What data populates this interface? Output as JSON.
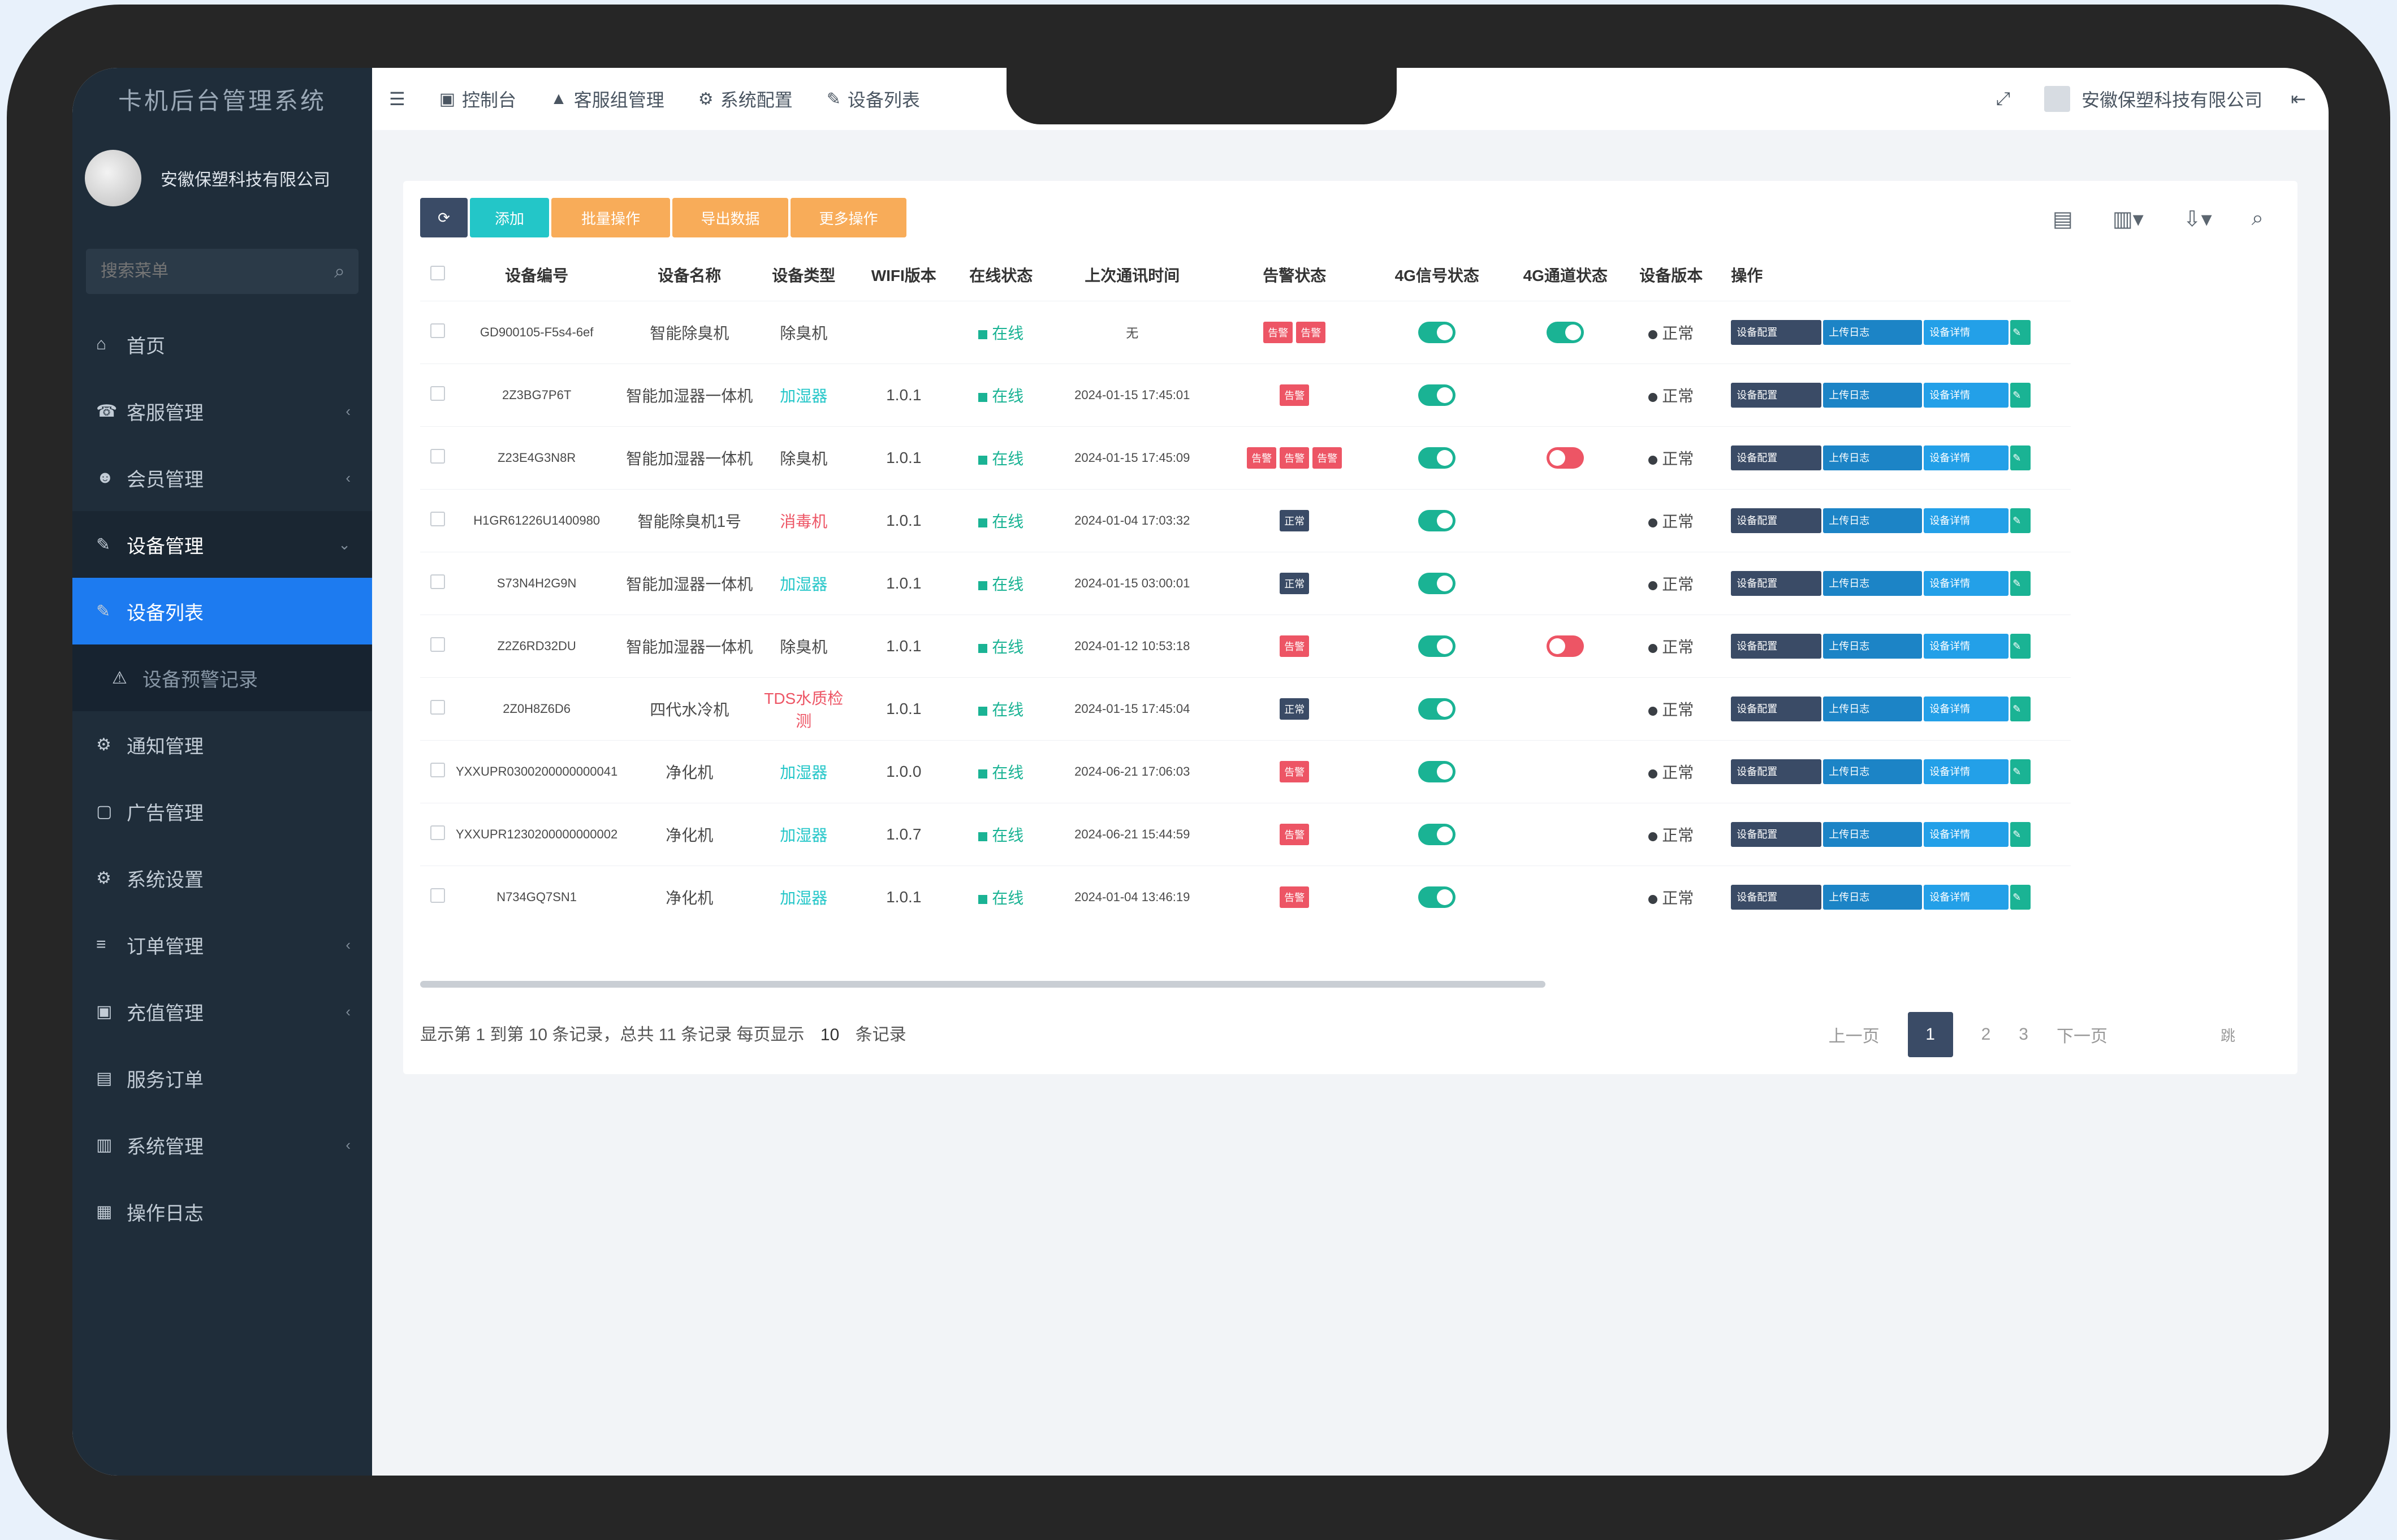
{
  "app": {
    "title": "卡机后台管理系统"
  },
  "user": {
    "name": "安徽保塑科技有限公司"
  },
  "sidebar": {
    "search_placeholder": "搜索菜单",
    "items": [
      {
        "label": "首页",
        "icon": "home-icon"
      },
      {
        "label": "客服管理",
        "icon": "headset-icon",
        "chevron": "‹"
      },
      {
        "label": "会员管理",
        "icon": "users-icon",
        "chevron": "‹"
      },
      {
        "label": "设备管理",
        "icon": "device-icon",
        "chevron": "⌄"
      },
      {
        "label": "设备列表",
        "icon": "list-icon"
      },
      {
        "label": "设备预警记录",
        "icon": "alert-icon"
      },
      {
        "label": "通知管理",
        "icon": "bell-icon"
      },
      {
        "label": "广告管理",
        "icon": "ad-icon"
      },
      {
        "label": "系统设置",
        "icon": "gear-icon"
      },
      {
        "label": "订单管理",
        "icon": "order-icon",
        "chevron": "‹"
      },
      {
        "label": "充值管理",
        "icon": "wallet-icon",
        "chevron": "‹"
      },
      {
        "label": "服务订单",
        "icon": "service-icon"
      },
      {
        "label": "系统管理",
        "icon": "system-icon",
        "chevron": "‹"
      },
      {
        "label": "操作日志",
        "icon": "log-icon"
      }
    ]
  },
  "topbar": {
    "menu_icon": "☰",
    "tabs": [
      {
        "label": "控制台",
        "icon": "▣"
      },
      {
        "label": "客服组管理",
        "icon": "▲"
      },
      {
        "label": "系统配置",
        "icon": "⚙"
      },
      {
        "label": "设备列表",
        "icon": "✎"
      }
    ],
    "fullscreen_icon": "⤢",
    "company": "安徽保塑科技有限公司",
    "collapse_icon": "⇤"
  },
  "toolbar": {
    "refresh_icon": "⟳",
    "add": "添加",
    "btn2": "批量操作",
    "btn3": "导出数据",
    "btn4": "更多操作"
  },
  "table": {
    "headers": [
      "设备编号",
      "设备名称",
      "设备类型",
      "WIFI版本",
      "在线状态",
      "上次通讯时间",
      "告警状态",
      "4G信号状态",
      "4G通道状态",
      "设备版本",
      "操作"
    ],
    "rows": [
      {
        "id": "GD900105-F5s4-6ef",
        "name": "智能除臭机",
        "type": "除臭机",
        "type_color": "normal",
        "wifi": "",
        "online": "在线",
        "last": "无",
        "alerts": [
          {
            "t": "告警",
            "c": "red"
          },
          {
            "t": "告警",
            "c": "red"
          }
        ],
        "sig": "on",
        "ch": "on",
        "status": "正常"
      },
      {
        "id": "2Z3BG7P6T",
        "name": "智能加湿器一体机",
        "type": "加湿器",
        "type_color": "cyan",
        "wifi": "1.0.1",
        "online": "在线",
        "last": "2024-01-15 17:45:01",
        "alerts": [
          {
            "t": "告警",
            "c": "red"
          }
        ],
        "sig": "on",
        "ch": "",
        "status": "正常"
      },
      {
        "id": "Z23E4G3N8R",
        "name": "智能加湿器一体机",
        "type": "除臭机",
        "type_color": "normal",
        "wifi": "1.0.1",
        "online": "在线",
        "last": "2024-01-15 17:45:09",
        "alerts": [
          {
            "t": "告警",
            "c": "red"
          },
          {
            "t": "告警",
            "c": "red"
          },
          {
            "t": "告警",
            "c": "red"
          }
        ],
        "sig": "on",
        "ch": "off",
        "status": "正常"
      },
      {
        "id": "H1GR61226U1400980",
        "name": "智能除臭机1号",
        "type": "消毒机",
        "type_color": "red",
        "wifi": "1.0.1",
        "online": "在线",
        "last": "2024-01-04 17:03:32",
        "alerts": [
          {
            "t": "正常",
            "c": "dark"
          }
        ],
        "sig": "on",
        "ch": "",
        "status": "正常"
      },
      {
        "id": "S73N4H2G9N",
        "name": "智能加湿器一体机",
        "type": "加湿器",
        "type_color": "cyan",
        "wifi": "1.0.1",
        "online": "在线",
        "last": "2024-01-15 03:00:01",
        "alerts": [
          {
            "t": "正常",
            "c": "dark"
          }
        ],
        "sig": "on",
        "ch": "",
        "status": "正常"
      },
      {
        "id": "Z2Z6RD32DU",
        "name": "智能加湿器一体机",
        "type": "除臭机",
        "type_color": "normal",
        "wifi": "1.0.1",
        "online": "在线",
        "last": "2024-01-12 10:53:18",
        "alerts": [
          {
            "t": "告警",
            "c": "red"
          }
        ],
        "sig": "on",
        "ch": "off",
        "status": "正常"
      },
      {
        "id": "2Z0H8Z6D6",
        "name": "四代水冷机",
        "type": "TDS水质检测",
        "type_color": "red",
        "wifi": "1.0.1",
        "online": "在线",
        "last": "2024-01-15 17:45:04",
        "alerts": [
          {
            "t": "正常",
            "c": "dark"
          }
        ],
        "sig": "on",
        "ch": "",
        "status": "正常"
      },
      {
        "id": "YXXUPR0300200000000041",
        "name": "净化机",
        "type": "加湿器",
        "type_color": "cyan",
        "wifi": "1.0.0",
        "online": "在线",
        "last": "2024-06-21 17:06:03",
        "alerts": [
          {
            "t": "告警",
            "c": "red"
          }
        ],
        "sig": "on",
        "ch": "",
        "status": "正常"
      },
      {
        "id": "YXXUPR1230200000000002",
        "name": "净化机",
        "type": "加湿器",
        "type_color": "cyan",
        "wifi": "1.0.7",
        "online": "在线",
        "last": "2024-06-21 15:44:59",
        "alerts": [
          {
            "t": "告警",
            "c": "red"
          }
        ],
        "sig": "on",
        "ch": "",
        "status": "正常"
      },
      {
        "id": "N734GQ7SN1",
        "name": "净化机",
        "type": "加湿器",
        "type_color": "cyan",
        "wifi": "1.0.1",
        "online": "在线",
        "last": "2024-01-04 13:46:19",
        "alerts": [
          {
            "t": "告警",
            "c": "red"
          }
        ],
        "sig": "on",
        "ch": "",
        "status": "正常"
      }
    ],
    "ops": {
      "op1": "设备配置",
      "op2": "上传日志",
      "op3": "设备详情",
      "op4": "✎"
    }
  },
  "pager": {
    "info": "显示第 1 到第 10 条记录，总共 11 条记录 每页显示",
    "per_page": "10",
    "suffix": "条记录",
    "prev": "上一页",
    "pages": [
      "1",
      "2",
      "3"
    ],
    "next": "下一页",
    "jump": "跳"
  },
  "colors": {
    "sidebar_bg": "#1f2d3a",
    "active_blue": "#1d7bf0",
    "accent_green": "#1ab394",
    "warning_orange": "#f8ac59",
    "danger_red": "#ed5565"
  }
}
